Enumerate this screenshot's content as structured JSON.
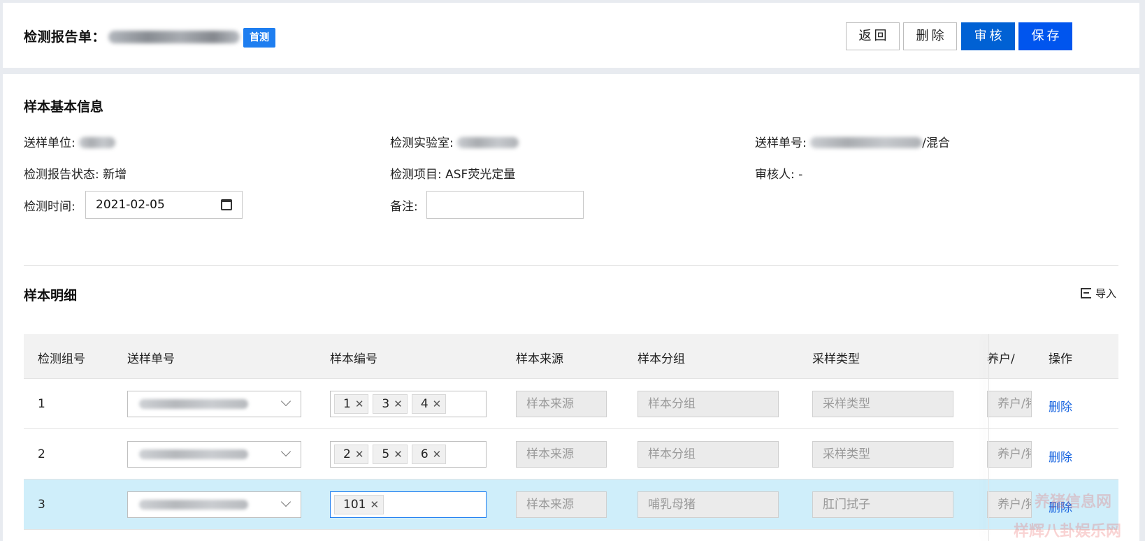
{
  "header": {
    "title": "检测报告单：",
    "badge": "首测",
    "buttons": {
      "back": "返回",
      "delete": "删除",
      "audit": "审核",
      "save": "保存"
    }
  },
  "basic_info": {
    "section_title": "样本基本信息",
    "sender_unit_label": "送样单位:",
    "lab_label": "检测实验室:",
    "order_no_label": "送样单号:",
    "order_no_suffix": "/混合",
    "status_label": "检测报告状态:",
    "status_value": "新增",
    "project_label": "检测项目:",
    "project_value": "ASF荧光定量",
    "auditor_label": "审核人:",
    "auditor_value": "-",
    "time_label": "检测时间:",
    "time_value": "2021-02-05",
    "remark_label": "备注:",
    "remark_value": ""
  },
  "detail": {
    "section_title": "样本明细",
    "import_label": "导入",
    "columns": [
      "检测组号",
      "送样单号",
      "样本编号",
      "样本来源",
      "样本分组",
      "采样类型",
      "养户/猪场",
      "操作"
    ],
    "rows": [
      {
        "group": "1",
        "tags": [
          "1",
          "3",
          "4"
        ],
        "source": "样本来源",
        "grouping": "样本分组",
        "sample_type": "采样类型",
        "farmer": "养户/猪场",
        "action": "删除"
      },
      {
        "group": "2",
        "tags": [
          "2",
          "5",
          "6"
        ],
        "source": "样本来源",
        "grouping": "样本分组",
        "sample_type": "采样类型",
        "farmer": "养户/猪场",
        "action": "删除"
      },
      {
        "group": "3",
        "tags": [
          "101"
        ],
        "source": "样本来源",
        "grouping": "哺乳母猪",
        "sample_type": "肛门拭子",
        "farmer": "养户/猪场",
        "action": "删除"
      }
    ]
  },
  "watermark": {
    "line1": "养猪信息网",
    "line2": "样辉八卦娱乐网"
  },
  "icons": {
    "calendar": "calendar-icon",
    "chevron": "chevron-down-icon",
    "close": "close-icon",
    "import": "import-icon"
  },
  "colors": {
    "primary": "#0061d4",
    "badge": "#1e7ef0",
    "link": "#1a66e0",
    "selected_row": "#cfeefa"
  }
}
